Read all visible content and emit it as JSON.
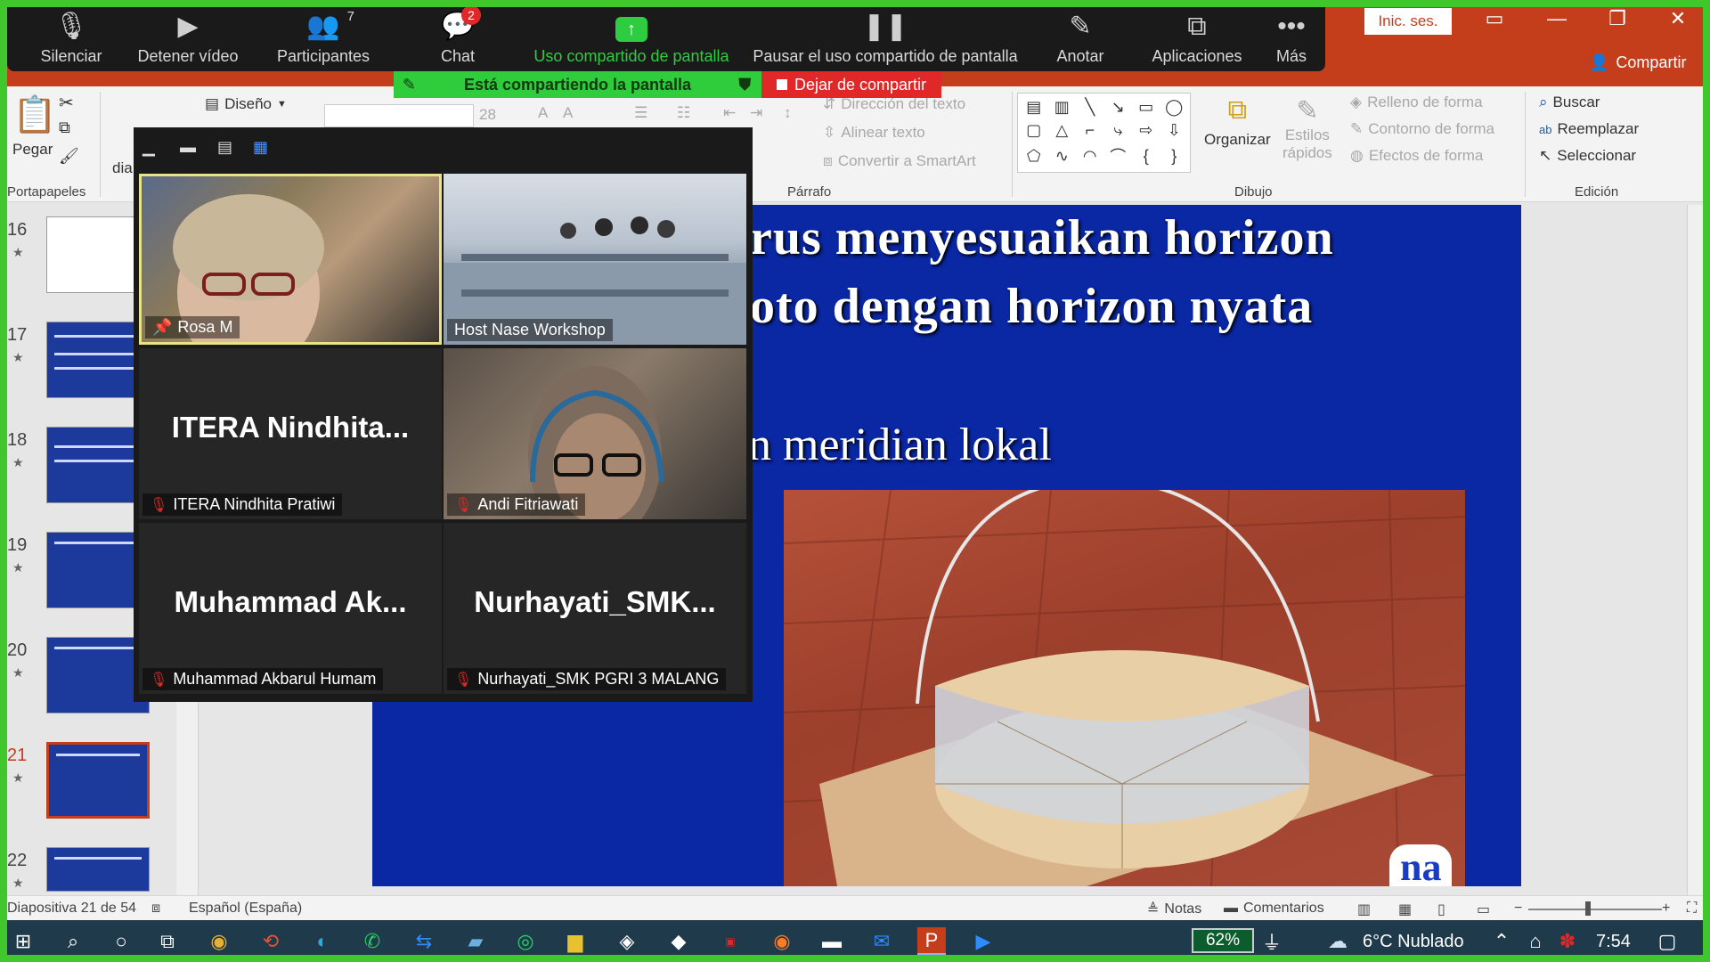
{
  "zoom": {
    "toolbar": {
      "mute": "Silenciar",
      "stop_video": "Detener vídeo",
      "participants": "Participantes",
      "participants_count": "7",
      "chat": "Chat",
      "chat_badge": "2",
      "share_screen": "Uso compartido de pantalla",
      "pause_share": "Pausar el uso compartido de pantalla",
      "annotate": "Anotar",
      "apps": "Aplicaciones",
      "more": "Más"
    },
    "sharing_banner": "Está compartiendo la pantalla",
    "stop_sharing": "Dejar de compartir",
    "participants": [
      {
        "name": "Rosa M",
        "display": "",
        "muted": false,
        "pinned": true
      },
      {
        "name": "Host Nase Workshop",
        "display": "",
        "muted": false,
        "pinned": false
      },
      {
        "name": "ITERA Nindhita Pratiwi",
        "display": "ITERA  Nindhita...",
        "muted": true
      },
      {
        "name": "Andi Fitriawati",
        "display": "",
        "muted": true
      },
      {
        "name": "Muhammad Akbarul Humam",
        "display": "Muhammad  Ak...",
        "muted": true
      },
      {
        "name": "Nurhayati_SMK PGRI 3 MALANG",
        "display": "Nurhayati_SMK...",
        "muted": true
      }
    ]
  },
  "powerpoint": {
    "login": "Inic. ses.",
    "share": "Compartir",
    "ribbon": {
      "paste": "Pegar",
      "clipboard": "Portapapeles",
      "design": "Diseño",
      "font_size": "28",
      "text_direction": "Dirección del texto",
      "align_text": "Alinear texto",
      "convert_smartart": "Convertir a SmartArt",
      "paragraph": "Párrafo",
      "drawing": "Dibujo",
      "arrange": "Organizar",
      "quick_styles_1": "Estilos",
      "quick_styles_2": "rápidos",
      "shape_fill": "Relleno de forma",
      "shape_outline": "Contorno de forma",
      "shape_effects": "Efectos de forma",
      "find": "Buscar",
      "replace": "Reemplazar",
      "select": "Seleccionar",
      "editing": "Edición",
      "cut_label": "dia"
    },
    "thumbnails": [
      {
        "num": "16"
      },
      {
        "num": "17"
      },
      {
        "num": "18"
      },
      {
        "num": "19"
      },
      {
        "num": "20"
      },
      {
        "num": "21",
        "selected": true
      },
      {
        "num": "22"
      }
    ],
    "slide": {
      "line1": "rus menyesuaikan horizon",
      "line2": "oto dengan horizon nyata",
      "line3": "n meridian lokal",
      "logo": "na"
    },
    "status": {
      "slide_of": "Diapositiva 21 de 54",
      "language": "Español (España)",
      "notes": "Notas",
      "comments": "Comentarios"
    }
  },
  "taskbar": {
    "battery": "62%",
    "weather": "6°C  Nublado",
    "time": "7:54"
  }
}
